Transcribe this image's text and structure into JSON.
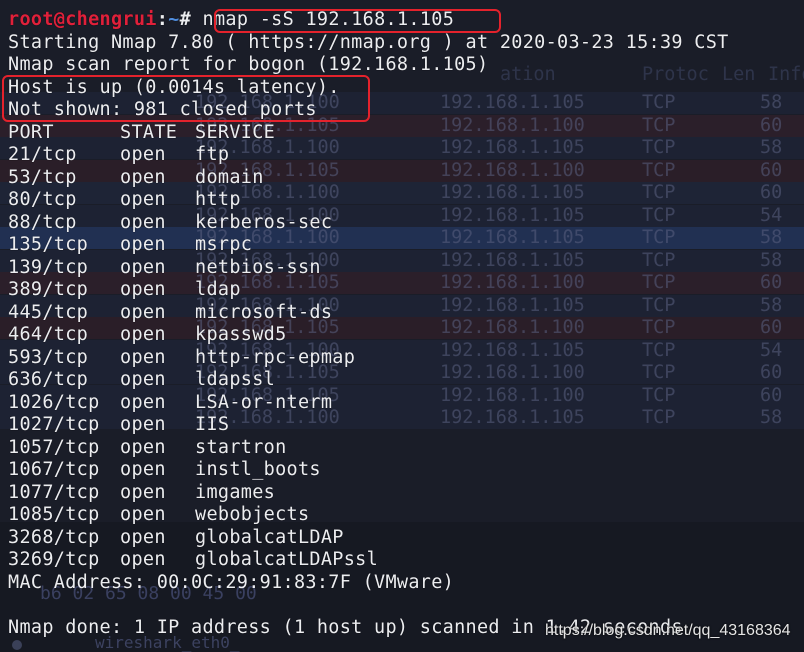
{
  "prompt": {
    "user_host": "root@chengrui",
    "sep": ":",
    "path": "~",
    "symbol": "#",
    "command": "nmap -sS 192.168.1.105"
  },
  "header_lines": [
    "Starting Nmap 7.80 ( https://nmap.org ) at 2020-03-23 15:39 CST",
    "Nmap scan report for bogon (192.168.1.105)",
    "Host is up (0.0014s latency).",
    "Not shown: 981 closed ports"
  ],
  "table": {
    "headers": [
      "PORT",
      "STATE",
      "SERVICE"
    ],
    "rows": [
      [
        "21/tcp",
        "open",
        "ftp"
      ],
      [
        "53/tcp",
        "open",
        "domain"
      ],
      [
        "80/tcp",
        "open",
        "http"
      ],
      [
        "88/tcp",
        "open",
        "kerberos-sec"
      ],
      [
        "135/tcp",
        "open",
        "msrpc"
      ],
      [
        "139/tcp",
        "open",
        "netbios-ssn"
      ],
      [
        "389/tcp",
        "open",
        "ldap"
      ],
      [
        "445/tcp",
        "open",
        "microsoft-ds"
      ],
      [
        "464/tcp",
        "open",
        "kpasswd5"
      ],
      [
        "593/tcp",
        "open",
        "http-rpc-epmap"
      ],
      [
        "636/tcp",
        "open",
        "ldapssl"
      ],
      [
        "1026/tcp",
        "open",
        "LSA-or-nterm"
      ],
      [
        "1027/tcp",
        "open",
        "IIS"
      ],
      [
        "1057/tcp",
        "open",
        "startron"
      ],
      [
        "1067/tcp",
        "open",
        "instl_boots"
      ],
      [
        "1077/tcp",
        "open",
        "imgames"
      ],
      [
        "1085/tcp",
        "open",
        "webobjects"
      ],
      [
        "3268/tcp",
        "open",
        "globalcatLDAP"
      ],
      [
        "3269/tcp",
        "open",
        "globalcatLDAPssl"
      ]
    ]
  },
  "mac_line": "MAC Address: 00:0C:29:91:83:7F (VMware)",
  "done_line": "Nmap done: 1 IP address (1 host up) scanned in 1.42 seconds",
  "watermark": "https://blog.csdn.net/qq_43168364",
  "background": {
    "header": [
      "ation",
      "Protoc",
      "Len",
      "Info"
    ],
    "rows": [
      [
        "192.168.1.100",
        "192.168.1.105",
        "TCP",
        "58",
        "#1d2233"
      ],
      [
        "192.168.1.105",
        "192.168.1.100",
        "TCP",
        "60",
        "#2b1f2a"
      ],
      [
        "192.168.1.100",
        "192.168.1.105",
        "TCP",
        "58",
        "#1d2233"
      ],
      [
        "192.168.1.105",
        "192.168.1.100",
        "TCP",
        "60",
        "#2a1e28"
      ],
      [
        "192.168.1.100",
        "192.168.1.105",
        "TCP",
        "60",
        "#1e2436"
      ],
      [
        "192.168.1.100",
        "192.168.1.105",
        "TCP",
        "54",
        "#1d2233"
      ],
      [
        "192.168.1.100",
        "192.168.1.105",
        "TCP",
        "58",
        "#213052"
      ],
      [
        "192.168.1.100",
        "192.168.1.105",
        "TCP",
        "58",
        "#1d2233"
      ],
      [
        "192.168.1.105",
        "192.168.1.100",
        "TCP",
        "60",
        "#2b1f2a"
      ],
      [
        "192.168.1.100",
        "192.168.1.105",
        "TCP",
        "58",
        "#1d2233"
      ],
      [
        "192.168.1.105",
        "192.168.1.100",
        "TCP",
        "60",
        "#2a1e28"
      ],
      [
        "192.168.1.100",
        "192.168.1.105",
        "TCP",
        "54",
        "#1d2233"
      ],
      [
        "192.168.1.105",
        "192.168.1.100",
        "TCP",
        "60",
        "#1d2233"
      ],
      [
        "192.168.1.105",
        "192.168.1.100",
        "TCP",
        "60",
        "#1d2233"
      ],
      [
        "192.168.1.100",
        "192.168.1.105",
        "TCP",
        "58",
        "#1d2233"
      ]
    ],
    "hex": "b6 02 65 08 00 45 00",
    "status": "wireshark_eth0_"
  },
  "colors": {
    "user": "#e0203a",
    "path": "#4f8dde",
    "text": "#ecedf0",
    "highlight": "#e4222c"
  }
}
